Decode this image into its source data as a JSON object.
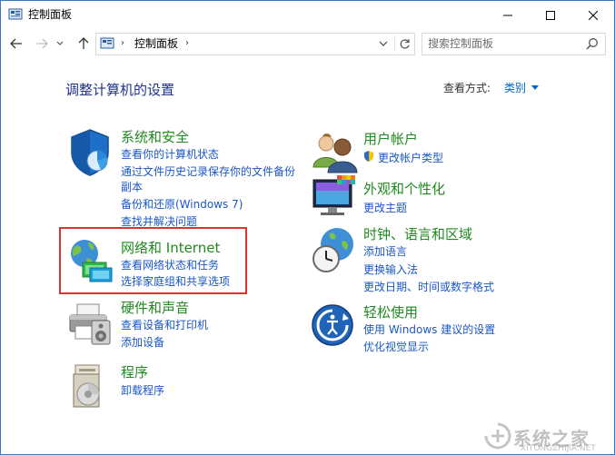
{
  "window": {
    "title": "控制面板"
  },
  "address": {
    "path_label": "控制面板",
    "separator": "›",
    "search_placeholder": "搜索控制面板"
  },
  "header": {
    "title": "调整计算机的设置",
    "view_by_label": "查看方式:",
    "view_by_value": "类别"
  },
  "categories": {
    "system_security": {
      "title": "系统和安全",
      "links": [
        "查看你的计算机状态",
        "通过文件历史记录保存你的文件备份",
        "副本",
        "备份和还原(Windows 7)",
        "查找并解决问题"
      ]
    },
    "network": {
      "title": "网络和 Internet",
      "links": [
        "查看网络状态和任务",
        "选择家庭组和共享选项"
      ]
    },
    "hardware": {
      "title": "硬件和声音",
      "links": [
        "查看设备和打印机",
        "添加设备"
      ]
    },
    "programs": {
      "title": "程序",
      "links": [
        "卸载程序"
      ]
    },
    "user_accounts": {
      "title": "用户帐户",
      "links": [
        "更改帐户类型"
      ]
    },
    "appearance": {
      "title": "外观和个性化",
      "links": [
        "更改主题"
      ]
    },
    "clock_region": {
      "title": "时钟、语言和区域",
      "links": [
        "添加语言",
        "更换输入法",
        "更改日期、时间或数字格式"
      ]
    },
    "ease": {
      "title": "轻松使用",
      "links": [
        "使用 Windows 建议的设置",
        "优化视觉显示"
      ]
    }
  },
  "watermark": {
    "text": "系统之家",
    "url": "XITONGZHIJIA.NET"
  },
  "colors": {
    "title_green": "#1f8a1f",
    "link_blue": "#1a57c6",
    "heading_blue": "#1e3287",
    "highlight_red": "#e0312e"
  }
}
